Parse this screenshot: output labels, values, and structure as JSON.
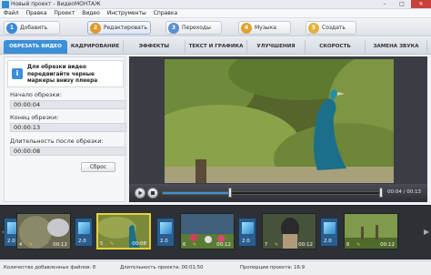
{
  "window": {
    "title": "Новый проект - ВидеоМОНТАЖ",
    "min_label": "–",
    "max_label": "□",
    "close_label": "✕"
  },
  "menu": [
    "Файл",
    "Правка",
    "Проект",
    "Видео",
    "Инструменты",
    "Справка"
  ],
  "steps": [
    {
      "num": "1",
      "label": "Добавить",
      "color": "#3a8ad6"
    },
    {
      "num": "2",
      "label": "Редактировать",
      "color": "#e09a2a"
    },
    {
      "num": "3",
      "label": "Переходы",
      "color": "#5a8fcf"
    },
    {
      "num": "4",
      "label": "Музыка",
      "color": "#e0a332"
    },
    {
      "num": "5",
      "label": "Создать",
      "color": "#e3b43c"
    }
  ],
  "tabs": [
    "ОБРЕЗАТЬ ВИДЕО",
    "КАДРИРОВАНИЕ",
    "ЭФФЕКТЫ",
    "ТЕКСТ И ГРАФИКА",
    "УЛУЧШЕНИЯ",
    "СКОРОСТЬ",
    "ЗАМЕНА ЗВУКА"
  ],
  "trim": {
    "hint": "Для обрезки видео передвигайте черные маркеры внизу плеера",
    "start_label": "Начало обрезки:",
    "start_value": "00:00:04",
    "end_label": "Конец обрезки:",
    "end_value": "00:00:13",
    "duration_label": "Длительность после обрезки:",
    "duration_value": "00:00:08",
    "reset_label": "Сброс"
  },
  "player": {
    "time": "00:04 / 00:13",
    "progress": 0.31,
    "marker_start": 0.31,
    "marker_end": 1.0
  },
  "clips": [
    {
      "num": "4",
      "duration": "00:12"
    },
    {
      "num": "5",
      "duration": "00:08"
    },
    {
      "num": "6",
      "duration": "00:12"
    },
    {
      "num": "7",
      "duration": "00:12"
    },
    {
      "num": "8",
      "duration": "00:12"
    }
  ],
  "transitions": [
    "2.0",
    "2.0",
    "2.0",
    "2.0",
    "2.0"
  ],
  "status": {
    "files": "Количество добавленных файлов: 8",
    "duration": "Длительность проекта: 00:01:50",
    "ratio": "Пропорции проекта: 16:9"
  }
}
